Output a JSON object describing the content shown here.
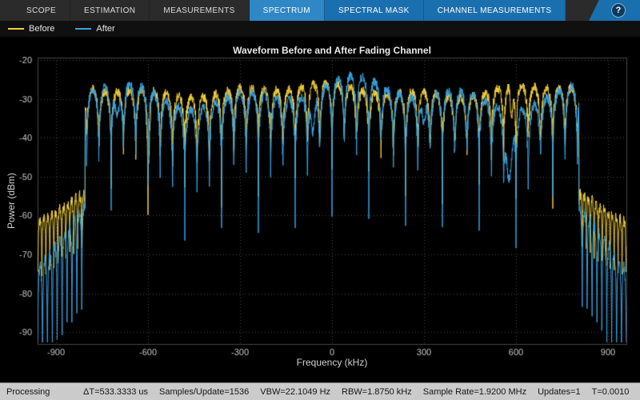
{
  "toolbar": {
    "tabs": [
      {
        "label": "SCOPE",
        "accent": false,
        "active": false
      },
      {
        "label": "ESTIMATION",
        "accent": false,
        "active": false
      },
      {
        "label": "MEASUREMENTS",
        "accent": false,
        "active": false
      },
      {
        "label": "SPECTRUM",
        "accent": true,
        "active": true
      },
      {
        "label": "SPECTRAL MASK",
        "accent": true,
        "active": false
      },
      {
        "label": "CHANNEL MEASUREMENTS",
        "accent": true,
        "active": false
      }
    ],
    "help_label": "?",
    "accent_color": "#1a6fae",
    "active_color": "#2f87c6"
  },
  "status": {
    "state": "Processing",
    "items": [
      "ΔT=533.3333 us",
      "Samples/Update=1536",
      "VBW=22.1049 Hz",
      "RBW=1.8750 kHz",
      "Sample Rate=1.9200 MHz",
      "Updates=1",
      "T=0.0010"
    ]
  },
  "chart_data": {
    "type": "line",
    "title": "Waveform Before and After Fading Channel",
    "xlabel": "Frequency (kHz)",
    "ylabel": "Power (dBm)",
    "xlim": [
      -960,
      960
    ],
    "ylim": [
      -93,
      -19.4
    ],
    "xticks": [
      -900,
      -600,
      -300,
      0,
      300,
      600,
      900
    ],
    "yticks": [
      -20,
      -30,
      -40,
      -50,
      -60,
      -70,
      -80,
      -90
    ],
    "grid": true,
    "legend_position": "top-left",
    "band_edge_khz": 805,
    "comb_period_khz": 40,
    "subcarrier_peaks": 40,
    "colors": {
      "background": "#000000",
      "grid": "#454545",
      "tick_text": "#c4c4c4"
    },
    "series": [
      {
        "name": "Before",
        "color": "#F2CF3A",
        "gen": {
          "seed": 2.1,
          "peak_dbm": -27.8,
          "valley_depth_db": 26,
          "env_amp": 1.2,
          "env_period1": 130,
          "env_amp2": 0.8,
          "env_period2": 47,
          "env_phase2": 1.7,
          "notches": [
            {
              "f": -598,
              "width": 6,
              "depth": 10
            },
            {
              "f": 585,
              "width": 5,
              "depth": 8
            }
          ],
          "oob_floor_dbm": -54,
          "oob_slope": 0.05,
          "oob_ripple_period": 13,
          "oob_phase": 2,
          "oob_spike_scale": 0.55
        }
      },
      {
        "name": "After",
        "color": "#37A2E2",
        "gen": {
          "seed": 7.3,
          "peak_dbm": -28.5,
          "valley_depth_db": 30,
          "env_amp": 2.5,
          "env_period1": 150,
          "env_amp2": 2.0,
          "env_period2": 57,
          "env_phase2": 0.4,
          "notches": [
            {
              "f": 578,
              "width": 12,
              "depth": 18
            },
            {
              "f": -62,
              "width": 8,
              "depth": 10
            },
            {
              "f": -700,
              "width": 10,
              "depth": 8
            },
            {
              "f": 300,
              "width": 7,
              "depth": 7
            }
          ],
          "oob_floor_dbm": -57,
          "oob_slope": 0.11,
          "oob_ripple_period": 16,
          "oob_phase": 5,
          "oob_spike_scale": 0.95
        }
      }
    ]
  }
}
